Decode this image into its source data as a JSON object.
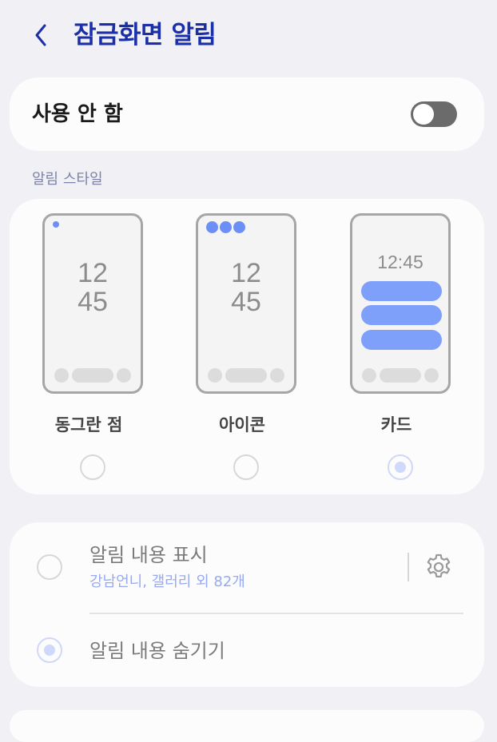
{
  "header": {
    "title": "잠금화면 알림",
    "back_icon": "chevron-left-icon"
  },
  "master_switch": {
    "label": "사용 안 함",
    "state": "off"
  },
  "style_section": {
    "header": "알림 스타일",
    "options": [
      {
        "label": "동그란 점",
        "preview_time": [
          "12",
          "45"
        ],
        "selected": false
      },
      {
        "label": "아이콘",
        "preview_time": [
          "12",
          "45"
        ],
        "selected": false
      },
      {
        "label": "카드",
        "preview_time": "12:45",
        "selected": true
      }
    ]
  },
  "content_section": {
    "show": {
      "title": "알림 내용 표시",
      "subtitle": "강남언니, 갤러리 외 82개",
      "selected": false,
      "settings_icon": "gear-icon"
    },
    "hide": {
      "title": "알림 내용 숨기기",
      "selected": true
    }
  },
  "colors": {
    "title": "#1b2fa8",
    "accent_blue": "#7fa0fa",
    "subtitle": "#98a9f2",
    "section_header": "#7d83a8",
    "background": "#f0f0f5",
    "card": "#fcfcfc"
  }
}
